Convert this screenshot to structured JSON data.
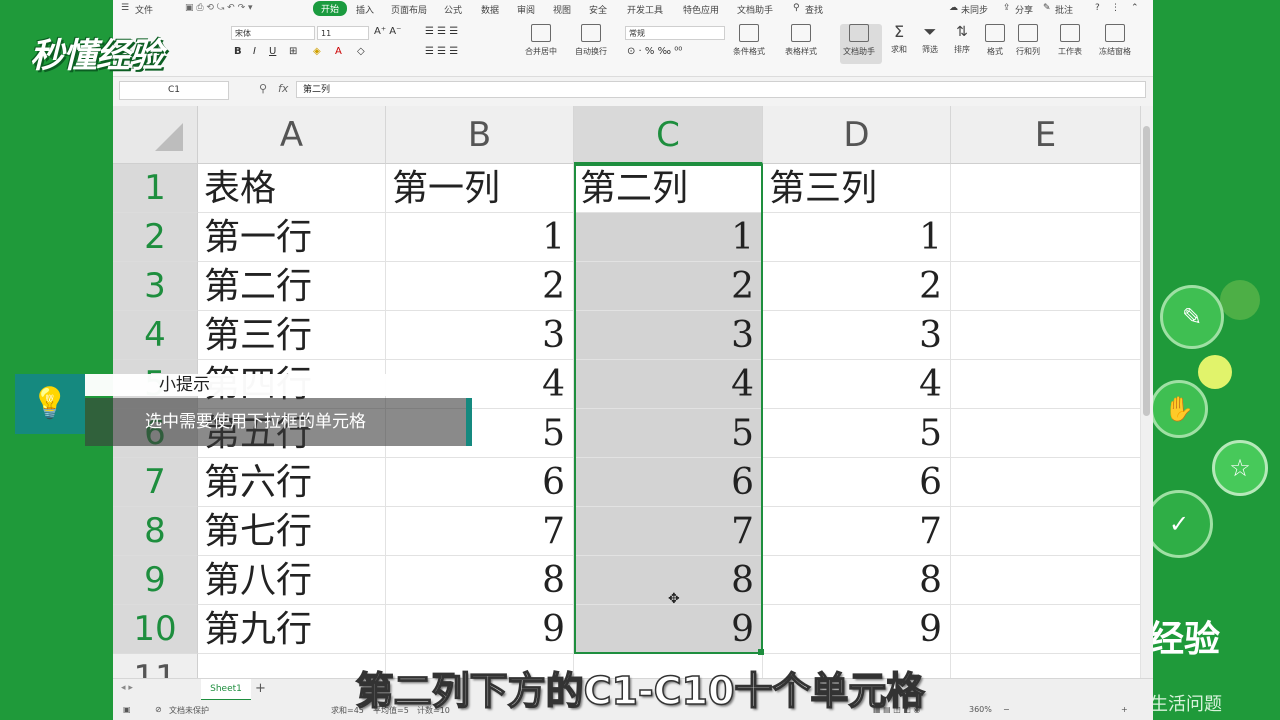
{
  "logo": {
    "text": "秒懂经验"
  },
  "menu": {
    "file": "文件",
    "tabs": [
      "开始",
      "插入",
      "页面布局",
      "公式",
      "数据",
      "审阅",
      "视图",
      "安全",
      "开发工具",
      "特色应用",
      "文档助手"
    ],
    "search": "查找",
    "sync": "未同步",
    "share": "分享",
    "comment": "批注"
  },
  "ribbon": {
    "font_name": "宋体",
    "font_size": "11",
    "merge": "合并居中",
    "wrap": "自动换行",
    "number_format": "常规",
    "cond_format": "条件格式",
    "table_style": "表格样式",
    "doc_assistant": "文档助手",
    "sum": "求和",
    "filter": "筛选",
    "sort": "排序",
    "format": "格式",
    "rowcol": "行和列",
    "worksheet": "工作表",
    "freeze": "冻结窗格"
  },
  "formula_bar": {
    "name_box": "C1",
    "fx": "fx",
    "content": "第二列"
  },
  "grid": {
    "columns": [
      "A",
      "B",
      "C",
      "D",
      "E"
    ],
    "rows": [
      {
        "n": "1",
        "a": "表格",
        "b": "第一列",
        "c": "第二列",
        "d": "第三列"
      },
      {
        "n": "2",
        "a": "第一行",
        "b": "1",
        "c": "1",
        "d": "1"
      },
      {
        "n": "3",
        "a": "第二行",
        "b": "2",
        "c": "2",
        "d": "2"
      },
      {
        "n": "4",
        "a": "第三行",
        "b": "3",
        "c": "3",
        "d": "3"
      },
      {
        "n": "5",
        "a": "第四行",
        "b": "4",
        "c": "4",
        "d": "4"
      },
      {
        "n": "6",
        "a": "第五行",
        "b": "5",
        "c": "5",
        "d": "5"
      },
      {
        "n": "7",
        "a": "第六行",
        "b": "6",
        "c": "6",
        "d": "6"
      },
      {
        "n": "8",
        "a": "第七行",
        "b": "7",
        "c": "7",
        "d": "7"
      },
      {
        "n": "9",
        "a": "第八行",
        "b": "8",
        "c": "8",
        "d": "8"
      },
      {
        "n": "10",
        "a": "第九行",
        "b": "9",
        "c": "9",
        "d": "9"
      },
      {
        "n": "11",
        "a": "",
        "b": "",
        "c": "",
        "d": ""
      }
    ],
    "selected_column": "C",
    "accent": "#1e8e3e"
  },
  "sheets": [
    "Sheet1"
  ],
  "status": {
    "protect": "文档未保护",
    "sum": "求和=45",
    "avg": "平均值=5",
    "count": "计数=10",
    "zoom": "360%"
  },
  "tip": {
    "title": "小提示",
    "body": "选中需要使用下拉框的单元格"
  },
  "subtitle": "第二列下方的C1-C10十个单元格",
  "brand_right": {
    "name": "经验",
    "slogan": "生活问题"
  }
}
